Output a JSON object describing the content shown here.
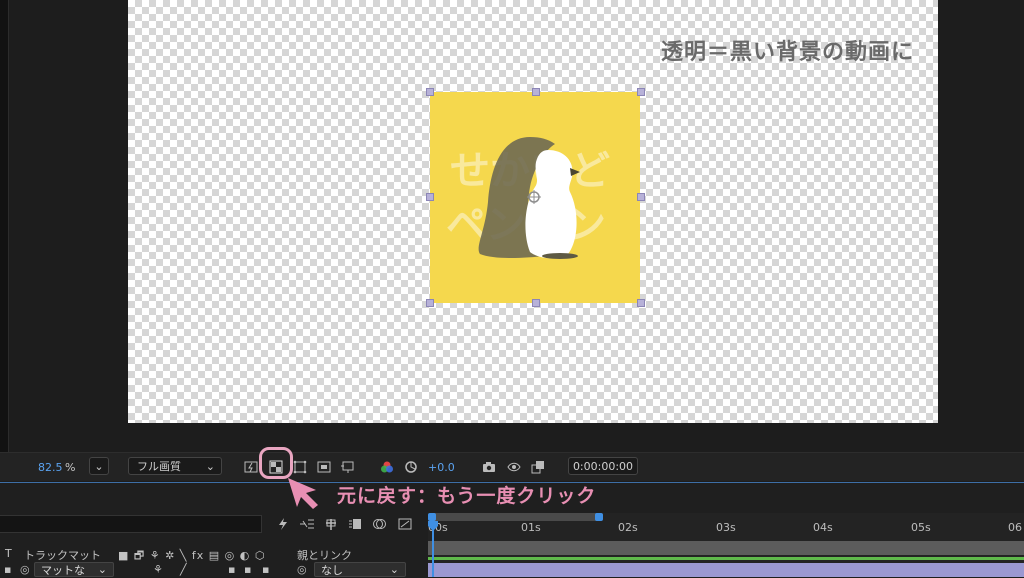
{
  "annotation": {
    "title": "透明＝黒い背景の動画に",
    "instruction": "元に戻す：もう一度クリック"
  },
  "layer_art": {
    "text_line1": "せかいど",
    "text_line2": "ペンギン"
  },
  "viewer_toolbar": {
    "zoom_value": "82.5",
    "zoom_unit": "%",
    "resolution_label": "フル画質",
    "exposure_value": "+0.0",
    "timecode": "0:00:00:00"
  },
  "timeline": {
    "ticks": [
      "00s",
      "01s",
      "02s",
      "03s",
      "04s",
      "05s",
      "06"
    ],
    "columns": {
      "type_marker": "T",
      "track_matte": "トラックマット",
      "parent_link": "親とリンク"
    },
    "row": {
      "matte_value": "マットな",
      "parent_value": "なし"
    }
  },
  "colors": {
    "accent_pink": "#e88fb3",
    "layer_yellow": "#f5d84d",
    "playhead_blue": "#3f8fe3",
    "audio_green": "#5fb94b",
    "clip_purple": "#9b98d1"
  }
}
